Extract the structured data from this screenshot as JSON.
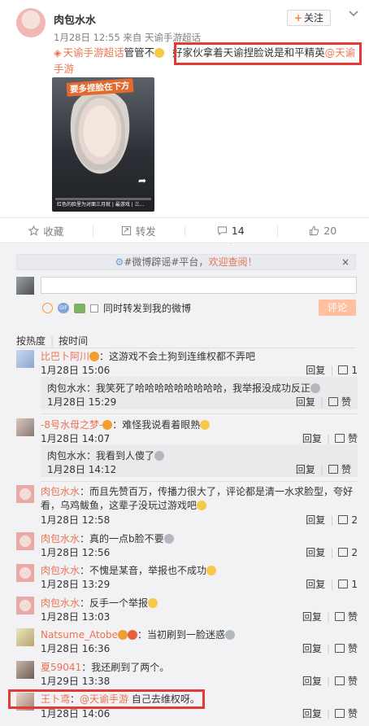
{
  "post": {
    "author": "肉包水水",
    "follow_label": "关注",
    "meta": "1月28日 12:55 来自 天谕手游超话",
    "supertopic": "天谕手游超话",
    "manager_text": "管管不",
    "highlight_text": "好家伙拿着天谕捏脸说是和平精英",
    "mention_part1": "@天谕",
    "mention_part2": "手游",
    "thumb_banner": "要多捏脸在下方",
    "thumb_caption": "红色的脸里为对面三月就 | 最游戏 | 三..."
  },
  "actions": [
    {
      "label": "收藏",
      "icon": "star-icon"
    },
    {
      "label": "转发",
      "icon": "repost-icon"
    },
    {
      "label": "14",
      "icon": "comment-icon"
    },
    {
      "label": "20",
      "icon": "like-icon"
    }
  ],
  "notice": {
    "tag": "#微博辟谣#平台，",
    "link": "欢迎查阅！",
    "close": "×"
  },
  "composer": {
    "sync_label": "同时转发到我的微博",
    "submit_label": "评论"
  },
  "sort": {
    "hot": "按热度",
    "time": "按时间"
  },
  "comments": [
    {
      "name": "比巴卜阿川",
      "text": "：这游戏不会土狗到连维权都不弄吧",
      "time": "1月28日 15:06",
      "reply": "回复",
      "likes": "1"
    },
    {
      "name": "肉包水水",
      "text": "：我笑死了哈哈哈哈哈哈哈哈哈，我举报没成功反正",
      "time": "1月28日 15:29",
      "reply": "回复",
      "likes": "赞"
    },
    {
      "name": "-8号水母之梦-",
      "text": "：难怪我说看着眼熟",
      "time": "1月28日 14:07",
      "reply": "回复",
      "likes": "赞"
    },
    {
      "name": "肉包水水",
      "text": "：我看到人傻了",
      "time": "1月28日 14:12",
      "reply": "回复",
      "likes": "赞"
    },
    {
      "name": "肉包水水",
      "text": "：而且先赞百万，传播力很大了，评论都是清一水求脸型，夸好看，乌鸡鲅鱼，这辈子没玩过游戏吧",
      "time": "1月28日 12:58",
      "reply": "回复",
      "likes": "2"
    },
    {
      "name": "肉包水水",
      "text": "：真的一点b脸不要",
      "time": "1月28日 12:56",
      "reply": "回复",
      "likes": "2"
    },
    {
      "name": "肉包水水",
      "text": "：不愧是某音，举报也不成功",
      "time": "1月28日 13:29",
      "reply": "回复",
      "likes": "1"
    },
    {
      "name": "肉包水水",
      "text": "：反手一个举报",
      "time": "1月28日 13:03",
      "reply": "回复",
      "likes": "赞"
    },
    {
      "name": "Natsume_Atobe",
      "text": "：当初刷到一脸迷惑",
      "time": "1月28日 16:36",
      "reply": "回复",
      "likes": "赞"
    },
    {
      "name": "夏59041",
      "text": "：我还刷到了两个。",
      "time": "1月29日 13:38",
      "reply": "回复",
      "likes": "赞"
    },
    {
      "name": "王卜鸢",
      "mention": "@天谕手游",
      "text": "自己去维权呀。",
      "time": "1月28日 14:06",
      "reply": "回复",
      "likes": "赞"
    }
  ]
}
